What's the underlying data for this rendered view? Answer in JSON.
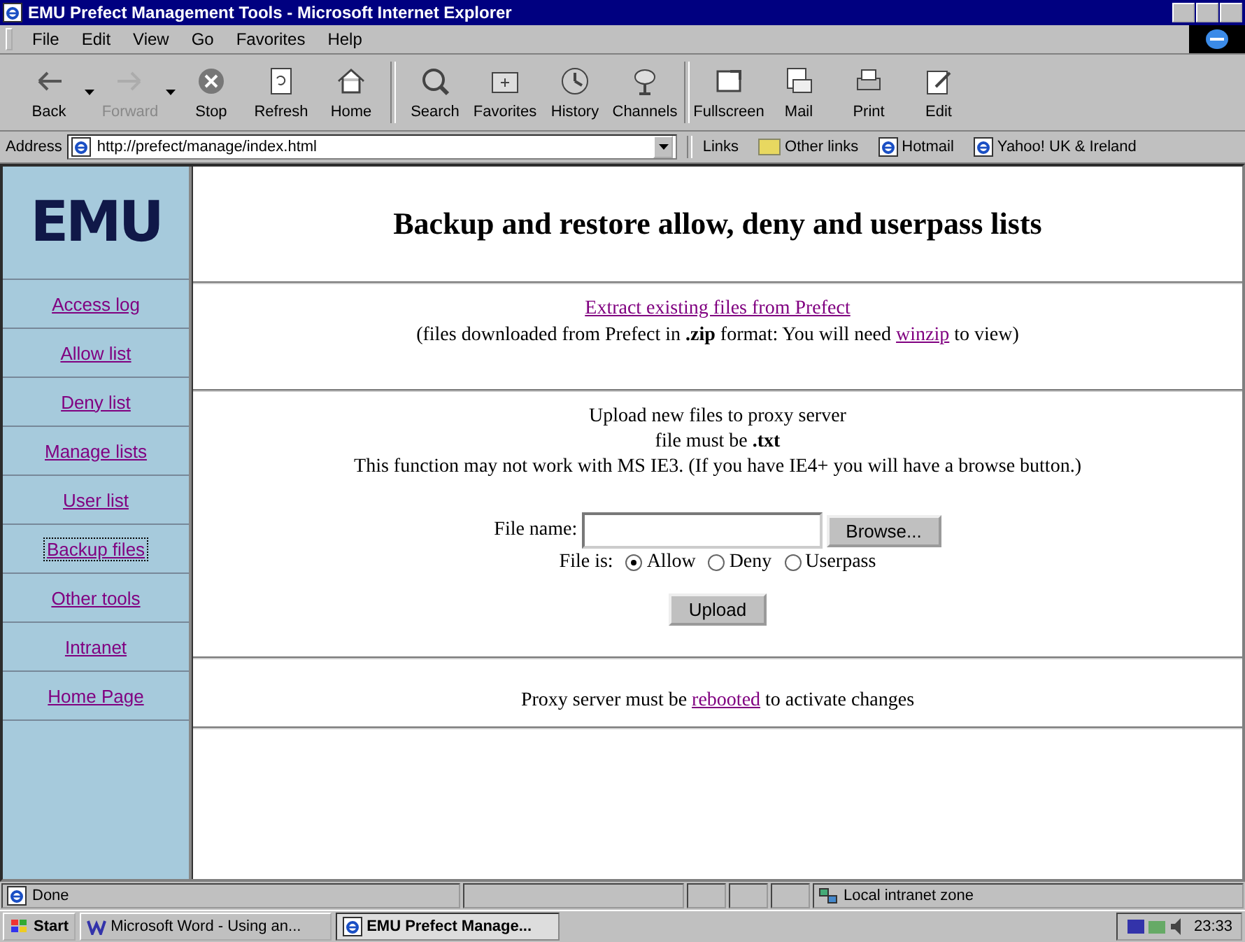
{
  "window": {
    "title": "EMU Prefect Management Tools - Microsoft Internet Explorer"
  },
  "menu": [
    "File",
    "Edit",
    "View",
    "Go",
    "Favorites",
    "Help"
  ],
  "toolbar": [
    {
      "label": "Back",
      "disabled": false,
      "dropdown": true
    },
    {
      "label": "Forward",
      "disabled": true,
      "dropdown": true
    },
    {
      "label": "Stop",
      "disabled": false,
      "dropdown": false
    },
    {
      "label": "Refresh",
      "disabled": false,
      "dropdown": false
    },
    {
      "label": "Home",
      "disabled": false,
      "dropdown": false
    },
    {
      "label": "Search",
      "disabled": false,
      "dropdown": false
    },
    {
      "label": "Favorites",
      "disabled": false,
      "dropdown": false
    },
    {
      "label": "History",
      "disabled": false,
      "dropdown": false
    },
    {
      "label": "Channels",
      "disabled": false,
      "dropdown": false
    },
    {
      "label": "Fullscreen",
      "disabled": false,
      "dropdown": false
    },
    {
      "label": "Mail",
      "disabled": false,
      "dropdown": false
    },
    {
      "label": "Print",
      "disabled": false,
      "dropdown": false
    },
    {
      "label": "Edit",
      "disabled": false,
      "dropdown": false
    }
  ],
  "address": {
    "label": "Address",
    "value": "http://prefect/manage/index.html"
  },
  "links": {
    "label": "Links",
    "items": [
      "Other links",
      "Hotmail",
      "Yahoo! UK & Ireland"
    ]
  },
  "sidebar": {
    "logo": "EMU",
    "items": [
      {
        "label": "Access log",
        "selected": false
      },
      {
        "label": "Allow list",
        "selected": false
      },
      {
        "label": "Deny list",
        "selected": false
      },
      {
        "label": "Manage lists",
        "selected": false
      },
      {
        "label": "User list",
        "selected": false
      },
      {
        "label": "Backup files",
        "selected": true
      },
      {
        "label": "Other tools",
        "selected": false
      },
      {
        "label": "Intranet",
        "selected": false
      },
      {
        "label": "Home Page",
        "selected": false
      }
    ]
  },
  "page": {
    "heading": "Backup and restore allow, deny and userpass lists",
    "extract_link": "Extract existing files from Prefect",
    "extract_note": [
      "(files downloaded from Prefect in **.zip** format: You will need ",
      "winzip",
      " to view)"
    ],
    "upload_lines": [
      "Upload new files to proxy server",
      "file must be **.txt**",
      "This function may not work with MS IE3. (If you have IE4+ you will have a browse button.)"
    ],
    "file_label": "File name:",
    "browse": "Browse...",
    "file_is": "File is:",
    "types": [
      {
        "label": "Allow",
        "selected": true
      },
      {
        "label": "Deny",
        "selected": false
      },
      {
        "label": "Userpass",
        "selected": false
      }
    ],
    "upload": "Upload",
    "footer": [
      "Proxy server must be ",
      "rebooted",
      " to activate changes"
    ]
  },
  "status_bar": {
    "text": "Done",
    "zone": "Local intranet zone"
  },
  "taskbar": {
    "start": "Start",
    "tasks": [
      {
        "label": "Microsoft Word - Using an...",
        "selected": false
      },
      {
        "label": "EMU Prefect Manage...",
        "selected": true
      }
    ],
    "time": "23:33"
  }
}
